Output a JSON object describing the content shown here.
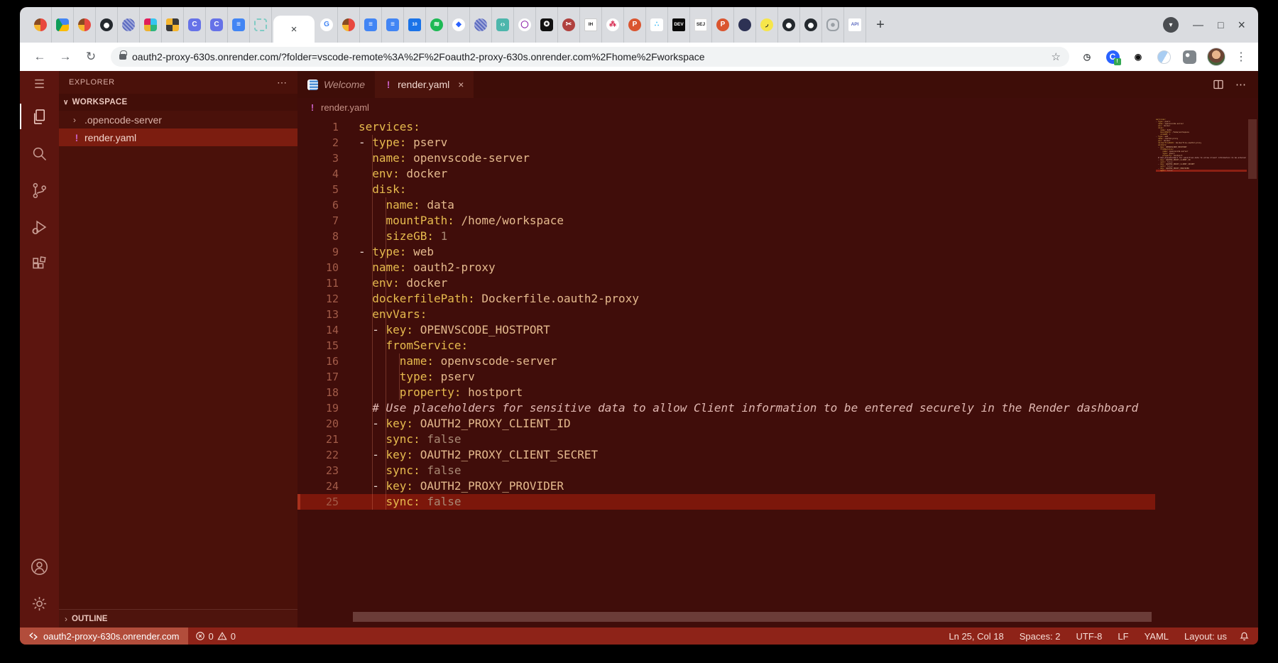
{
  "browser": {
    "tabstrip": {
      "pinned_before_active": [
        {
          "name": "pinned-tab-multicolor-app",
          "bg": "conic-gradient(#e8483f 0% 50%, #f5b52e 50% 75%, #8a4a22 75% 100%)",
          "round": "50%"
        },
        {
          "name": "pinned-tab-google-drive",
          "bg": "conic-gradient(from 210deg, #0f9d58 0% 33%, #4285f4 33% 66%, #fbbc04 66% 100%)",
          "round": "4px"
        },
        {
          "name": "pinned-tab-multicolor-app",
          "bg": "conic-gradient(#e8483f 0% 50%, #f5b52e 50% 75%, #8a4a22 75% 100%)",
          "round": "50%"
        },
        {
          "name": "pinned-tab-github",
          "bg": "radial-gradient(circle at 50% 55%, #ffffff 0 28%, #24292e 30%)",
          "round": "50%"
        },
        {
          "name": "pinned-tab-striped-ball",
          "bg": "repeating-linear-gradient(45deg,#5c6bc0 0 2px,#9fa8da 2px 4px)",
          "round": "50%"
        },
        {
          "name": "pinned-tab-slack",
          "bg": "conic-gradient(#36c5f0 0% 25%, #2eb67d 25% 50%, #ecb22e 50% 75%, #e01e5a 75% 100%)",
          "round": "4px"
        },
        {
          "name": "pinned-tab-grid-yellow",
          "bg": "conic-gradient(#3a3a3a 0% 25%, #f5b52e 25% 50%, #3a3a3a 50% 75%, #f5b52e 75% 100%)",
          "round": "3px"
        },
        {
          "name": "pinned-tab-c-app",
          "bg": "#6672e8",
          "glyph": "C",
          "fg": "#ffffff",
          "round": "5px"
        },
        {
          "name": "pinned-tab-c-app",
          "bg": "#6672e8",
          "glyph": "C",
          "fg": "#ffffff",
          "round": "5px"
        },
        {
          "name": "pinned-tab-google-docs",
          "bg": "#4285f4",
          "glyph": "≡",
          "fg": "#ffffff",
          "round": "4px"
        },
        {
          "name": "pinned-tab-dashed-frame",
          "bg": "transparent",
          "border": "2px dashed #80cbc4",
          "round": "4px"
        }
      ],
      "active_tab_close": "×",
      "pinned_after_active": [
        {
          "name": "pinned-tab-google",
          "bg": "#ffffff",
          "glyph": "G",
          "fg": "#4285f4",
          "round": "50%"
        },
        {
          "name": "pinned-tab-multicolor-app",
          "bg": "conic-gradient(#e8483f 0% 50%, #f5b52e 50% 75%, #8a4a22 75% 100%)",
          "round": "50%"
        },
        {
          "name": "pinned-tab-google-docs",
          "bg": "#4285f4",
          "glyph": "≡",
          "fg": "#ffffff",
          "round": "4px"
        },
        {
          "name": "pinned-tab-google-docs",
          "bg": "#4285f4",
          "glyph": "≡",
          "fg": "#ffffff",
          "round": "4px"
        },
        {
          "name": "pinned-tab-google-calendar",
          "bg": "#1a73e8",
          "glyph": "10",
          "fg": "#ffffff",
          "round": "3px",
          "small": true
        },
        {
          "name": "pinned-tab-spotify",
          "bg": "#1db954",
          "glyph": "≋",
          "fg": "#ffffff",
          "round": "50%"
        },
        {
          "name": "pinned-tab-blue-gem",
          "bg": "#ffffff",
          "glyph": "◆",
          "fg": "#2962ff",
          "round": "50%"
        },
        {
          "name": "pinned-tab-striped-ball",
          "bg": "repeating-linear-gradient(45deg,#5c6bc0 0 2px,#9fa8da 2px 4px)",
          "round": "50%"
        },
        {
          "name": "pinned-tab-code-teal",
          "bg": "#4db6ac",
          "glyph": "‹›",
          "fg": "#ffffff",
          "round": "4px"
        },
        {
          "name": "pinned-tab-purple-ring",
          "bg": "#ffffff",
          "glyph": "◯",
          "fg": "#8e24aa",
          "round": "50%"
        },
        {
          "name": "pinned-tab-star-badge",
          "bg": "#111111",
          "glyph": "✪",
          "fg": "#ffffff",
          "round": "4px"
        },
        {
          "name": "pinned-tab-scissors",
          "bg": "#b0413e",
          "glyph": "✂",
          "fg": "#ffffff",
          "round": "50%"
        },
        {
          "name": "pinned-tab-indie-hackers",
          "bg": "#ffffff",
          "glyph": "IH",
          "fg": "#1f1f1f",
          "round": "2px",
          "small": true,
          "border": "1px solid #cccccc"
        },
        {
          "name": "pinned-tab-share-red",
          "bg": "#ffffff",
          "glyph": "⁂",
          "fg": "#d6254d",
          "round": "50%"
        },
        {
          "name": "pinned-tab-product-hunt",
          "bg": "#da552f",
          "glyph": "P",
          "fg": "#ffffff",
          "round": "50%"
        },
        {
          "name": "pinned-tab-dots-multi",
          "bg": "#ffffff",
          "glyph": "∴",
          "fg": "#29b6f6",
          "round": "3px"
        },
        {
          "name": "pinned-tab-dev-to",
          "bg": "#0a0a0a",
          "glyph": "DEV",
          "fg": "#ffffff",
          "round": "2px",
          "small": true
        },
        {
          "name": "pinned-tab-sej",
          "bg": "#ffffff",
          "glyph": "SEJ",
          "fg": "#222222",
          "round": "2px",
          "small": true,
          "border": "1px solid #dddddd"
        },
        {
          "name": "pinned-tab-product-hunt",
          "bg": "#da552f",
          "glyph": "P",
          "fg": "#ffffff",
          "round": "50%"
        },
        {
          "name": "pinned-tab-navy-circle",
          "bg": "#2d3254",
          "round": "50%"
        },
        {
          "name": "pinned-tab-yellow-circle",
          "bg": "#f6e64b",
          "glyph": "◞",
          "fg": "#222222",
          "round": "50%"
        },
        {
          "name": "pinned-tab-github",
          "bg": "radial-gradient(circle at 50% 55%, #ffffff 0 28%, #24292e 30%)",
          "round": "50%"
        },
        {
          "name": "pinned-tab-github",
          "bg": "radial-gradient(circle at 50% 55%, #ffffff 0 28%, #24292e 30%)",
          "round": "50%"
        },
        {
          "name": "pinned-tab-gear-outline",
          "bg": "radial-gradient(circle,#9aa0a6 0 2.5px,transparent 3px)",
          "border": "2px solid #9aa0a6",
          "round": "7px"
        },
        {
          "name": "pinned-tab-api",
          "bg": "#ffffff",
          "glyph": "API",
          "fg": "#5c6bc0",
          "round": "2px",
          "small": true
        }
      ],
      "new_tab": "+",
      "tab_search": "▾",
      "minimize": "—",
      "maximize": "□",
      "close": "×"
    },
    "toolbar": {
      "back": "←",
      "forward": "→",
      "reload": "↻",
      "url": "oauth2-proxy-630s.onrender.com/?folder=vscode-remote%3A%2F%2Foauth2-proxy-630s.onrender.com%2Fhome%2Fworkspace",
      "star": "☆",
      "menu": "⋮",
      "extensions": [
        {
          "name": "extension-clock",
          "glyph": "◷",
          "fg": "#3c4043"
        },
        {
          "name": "extension-c-badged",
          "bg": "#2962ff",
          "glyph": "C",
          "fg": "#ffffff",
          "round": "50%",
          "badge": "!"
        },
        {
          "name": "extension-target",
          "glyph": "◉",
          "fg": "#111111"
        },
        {
          "name": "extension-half-moon",
          "bg": "linear-gradient(120deg,#a9cdf2 0 55%,#ffffff 55%)",
          "border": "1px solid #c9d2dc",
          "round": "50%"
        },
        {
          "name": "extension-puzzle",
          "bg": "radial-gradient(circle at 35% 35%, #ffffff 0 2.5px, #80868b 3px)",
          "round": "5px"
        }
      ]
    }
  },
  "vscode": {
    "activity": {
      "menu": "☰"
    },
    "explorer": {
      "title": "EXPLORER",
      "actions": "⋯",
      "section_chevron": "∨",
      "section": "WORKSPACE",
      "items": [
        {
          "chevron": "›",
          "label": ".opencode-server",
          "badge": ""
        },
        {
          "chevron": "",
          "label": "render.yaml",
          "badge": "!"
        }
      ],
      "outline_chevron": "›",
      "outline": "OUTLINE"
    },
    "tabs": {
      "welcome_label": "Welcome",
      "file_badge": "!",
      "file_label": "render.yaml",
      "close": "×",
      "more": "⋯"
    },
    "breadcrumb": {
      "badge": "!",
      "file": "render.yaml"
    },
    "editor": {
      "language": "yaml",
      "lines": [
        {
          "n": 1,
          "t": [
            [
              "k",
              "services:"
            ]
          ]
        },
        {
          "n": 2,
          "t": [
            [
              "d",
              "- "
            ],
            [
              "k",
              "type:"
            ],
            [
              "v",
              " pserv"
            ]
          ]
        },
        {
          "n": 3,
          "t": [
            [
              "d",
              "  "
            ],
            [
              "k",
              "name:"
            ],
            [
              "v",
              " openvscode-server"
            ]
          ]
        },
        {
          "n": 4,
          "t": [
            [
              "d",
              "  "
            ],
            [
              "k",
              "env:"
            ],
            [
              "v",
              " docker"
            ]
          ]
        },
        {
          "n": 5,
          "t": [
            [
              "d",
              "  "
            ],
            [
              "k",
              "disk:"
            ]
          ]
        },
        {
          "n": 6,
          "t": [
            [
              "d",
              "    "
            ],
            [
              "k",
              "name:"
            ],
            [
              "v",
              " data"
            ]
          ]
        },
        {
          "n": 7,
          "t": [
            [
              "d",
              "    "
            ],
            [
              "k",
              "mountPath:"
            ],
            [
              "v",
              " /home/workspace"
            ]
          ]
        },
        {
          "n": 8,
          "t": [
            [
              "d",
              "    "
            ],
            [
              "k",
              "sizeGB:"
            ],
            [
              "n",
              " 1"
            ]
          ]
        },
        {
          "n": 9,
          "t": [
            [
              "d",
              "- "
            ],
            [
              "k",
              "type:"
            ],
            [
              "v",
              " web"
            ]
          ]
        },
        {
          "n": 10,
          "t": [
            [
              "d",
              "  "
            ],
            [
              "k",
              "name:"
            ],
            [
              "v",
              " oauth2-proxy"
            ]
          ]
        },
        {
          "n": 11,
          "t": [
            [
              "d",
              "  "
            ],
            [
              "k",
              "env:"
            ],
            [
              "v",
              " docker"
            ]
          ]
        },
        {
          "n": 12,
          "t": [
            [
              "d",
              "  "
            ],
            [
              "k",
              "dockerfilePath:"
            ],
            [
              "v",
              " Dockerfile.oauth2-proxy"
            ]
          ]
        },
        {
          "n": 13,
          "t": [
            [
              "d",
              "  "
            ],
            [
              "k",
              "envVars:"
            ]
          ]
        },
        {
          "n": 14,
          "t": [
            [
              "d",
              "  - "
            ],
            [
              "k",
              "key:"
            ],
            [
              "v",
              " OPENVSCODE_HOSTPORT"
            ]
          ]
        },
        {
          "n": 15,
          "t": [
            [
              "d",
              "    "
            ],
            [
              "k",
              "fromService:"
            ]
          ]
        },
        {
          "n": 16,
          "t": [
            [
              "d",
              "      "
            ],
            [
              "k",
              "name:"
            ],
            [
              "v",
              " openvscode-server"
            ]
          ]
        },
        {
          "n": 17,
          "t": [
            [
              "d",
              "      "
            ],
            [
              "k",
              "type:"
            ],
            [
              "v",
              " pserv"
            ]
          ]
        },
        {
          "n": 18,
          "t": [
            [
              "d",
              "      "
            ],
            [
              "k",
              "property:"
            ],
            [
              "v",
              " hostport"
            ]
          ]
        },
        {
          "n": 19,
          "t": [
            [
              "d",
              "  "
            ],
            [
              "c",
              "# Use placeholders for sensitive data to allow Client information to be entered securely in the Render dashboard"
            ]
          ]
        },
        {
          "n": 20,
          "t": [
            [
              "d",
              "  - "
            ],
            [
              "k",
              "key:"
            ],
            [
              "v",
              " OAUTH2_PROXY_CLIENT_ID"
            ]
          ]
        },
        {
          "n": 21,
          "t": [
            [
              "d",
              "    "
            ],
            [
              "k",
              "sync:"
            ],
            [
              "n",
              " false"
            ]
          ]
        },
        {
          "n": 22,
          "t": [
            [
              "d",
              "  - "
            ],
            [
              "k",
              "key:"
            ],
            [
              "v",
              " OAUTH2_PROXY_CLIENT_SECRET"
            ]
          ]
        },
        {
          "n": 23,
          "t": [
            [
              "d",
              "    "
            ],
            [
              "k",
              "sync:"
            ],
            [
              "n",
              " false"
            ]
          ]
        },
        {
          "n": 24,
          "t": [
            [
              "d",
              "  - "
            ],
            [
              "k",
              "key:"
            ],
            [
              "v",
              " OAUTH2_PROXY_PROVIDER"
            ]
          ]
        },
        {
          "n": 25,
          "t": [
            [
              "d",
              "    "
            ],
            [
              "k",
              "sync:"
            ],
            [
              "n",
              " false"
            ]
          ],
          "current": true
        }
      ]
    },
    "status": {
      "remote": "oauth2-proxy-630s.onrender.com",
      "errors": "0",
      "warnings": "0",
      "line_col": "Ln 25, Col 18",
      "indentation": "Spaces: 2",
      "encoding": "UTF-8",
      "eol": "LF",
      "language": "YAML",
      "layout": "Layout: us"
    },
    "theme": {
      "editor_bg": "#400d0a",
      "sidebar_bg": "#4a110a",
      "activitybar_bg": "#5c150f",
      "statusbar_bg": "#8e2318",
      "remote_bg": "#b24d3b",
      "selection_bg": "#7c1d10",
      "current_line_bg": "#7c170b",
      "key_color": "#e7bb4e",
      "value_color": "#e5ba8e",
      "comment_color": "#e0b7b1",
      "warning_badge_color": "#c75fc2"
    }
  }
}
